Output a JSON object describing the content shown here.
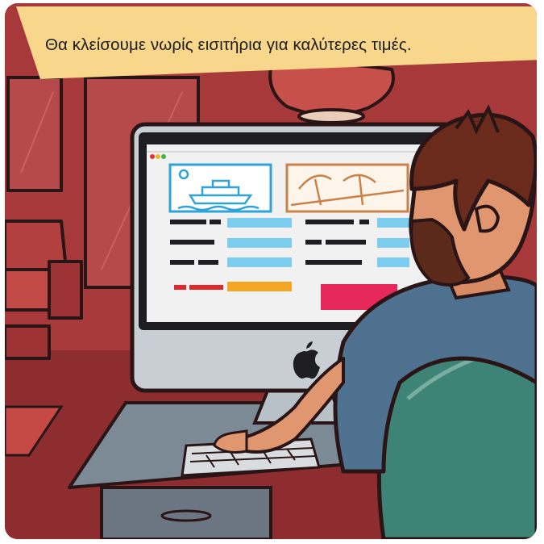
{
  "caption": {
    "text": "Θα κλείσουμε νωρίς εισιτήρια για καλύτερες τιμές."
  },
  "scene": {
    "subject": "man-booking-travel-tickets-on-computer",
    "monitor_logo": "apple-logo-icon",
    "screen": {
      "left_image": "cruise-ship-icon",
      "right_image": "beach-umbrella-icon",
      "accent_colors": {
        "ship_blue": "#2ea3d8",
        "beach_orange": "#c9824a",
        "field_blue": "#7ccdee",
        "orange_bar": "#f4a623",
        "red_bar": "#e0282c",
        "button_pink": "#e7285a"
      }
    },
    "colors": {
      "room_red": "#a8393a",
      "shirt_blue": "#4f7190",
      "chair_green": "#3d8476",
      "caption_bg": "#f8d68b"
    }
  }
}
